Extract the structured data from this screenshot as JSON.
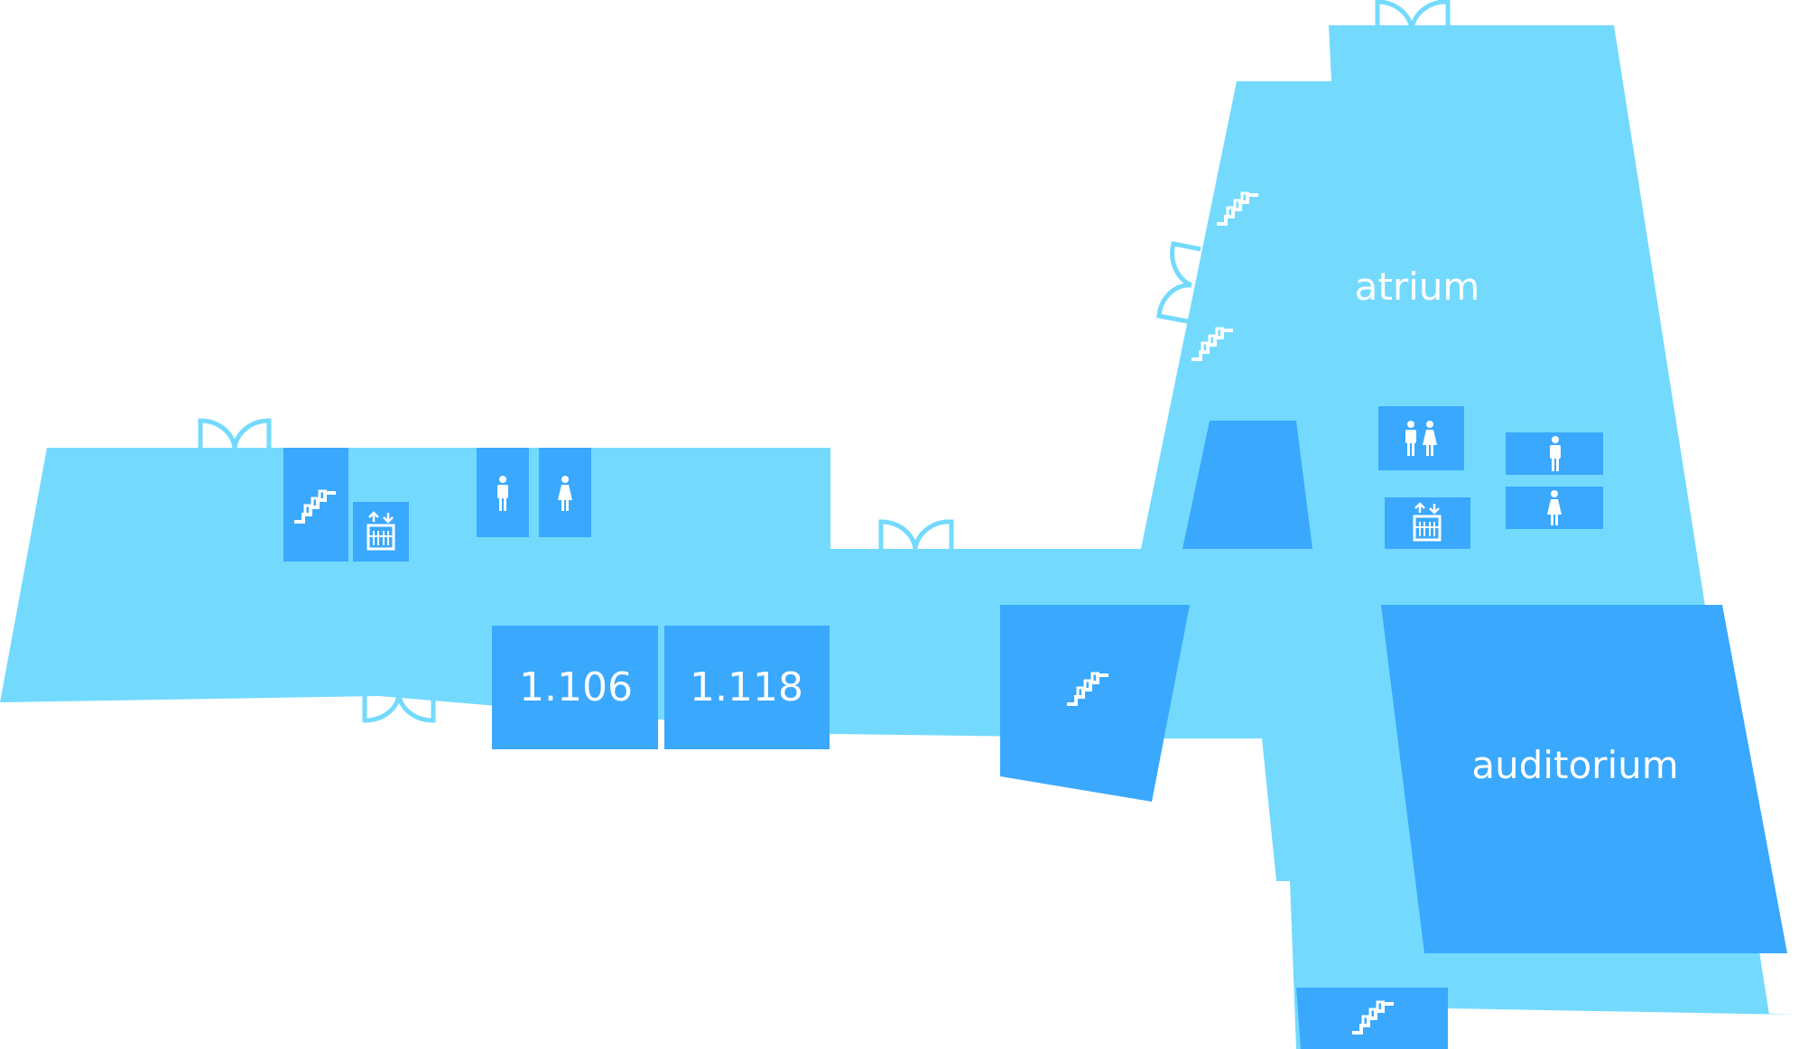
{
  "map": {
    "colors": {
      "corridor": "#73DAFE",
      "room": "#3AA8FD",
      "icon": "#ffffff",
      "background": "#ffffff"
    },
    "labels": {
      "atrium": "atrium",
      "auditorium": "auditorium",
      "room_1106": "1.106",
      "room_1118": "1.118"
    },
    "icons": [
      "stairs-icon",
      "elevator-icon",
      "male-restroom-icon",
      "female-restroom-icon",
      "unisex-restroom-icon",
      "door-icon"
    ]
  }
}
